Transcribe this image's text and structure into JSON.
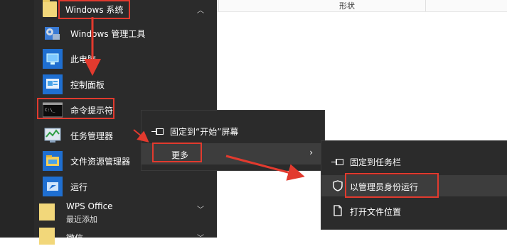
{
  "start_menu": {
    "items": [
      {
        "label": "Windows 系统",
        "icon": "folder-icon"
      },
      {
        "label": "Windows 管理工具",
        "icon": "gear-tools-icon"
      },
      {
        "label": "此电脑",
        "icon": "computer-icon"
      },
      {
        "label": "控制面板",
        "icon": "control-panel-icon"
      },
      {
        "label": "命令提示符",
        "icon": "terminal-icon"
      },
      {
        "label": "任务管理器",
        "icon": "task-manager-icon"
      },
      {
        "label": "文件资源管理器",
        "icon": "folder-icon"
      },
      {
        "label": "运行",
        "icon": "run-icon"
      },
      {
        "label": "WPS Office",
        "sub": "最近添加",
        "icon": "folder-icon"
      },
      {
        "label": "微信",
        "icon": "folder-icon"
      }
    ]
  },
  "file_view": {
    "column_header": "形状"
  },
  "context_menu": {
    "pin_start": "固定到“开始”屏幕",
    "more": "更多"
  },
  "submenu": {
    "pin_taskbar": "固定到任务栏",
    "run_as_admin": "以管理员身份运行",
    "open_location": "打开文件位置"
  },
  "colors": {
    "accent_red": "#e23a2e",
    "menu_bg": "#2b2b2b"
  }
}
